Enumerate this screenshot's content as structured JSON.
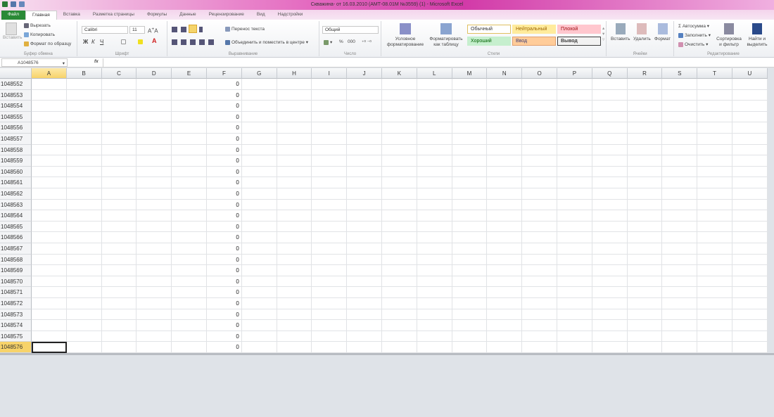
{
  "window": {
    "title": "Скважина- от 16.03.2010 (АМТ-08.01М №3559) (1) - Microsoft Excel"
  },
  "tabs": [
    "Файл",
    "Главная",
    "Вставка",
    "Разметка страницы",
    "Формулы",
    "Данные",
    "Рецензирование",
    "Вид",
    "Надстройки"
  ],
  "ribbon": {
    "clipboard": {
      "paste": "Вставить",
      "cut": "Вырезать",
      "copy": "Копировать",
      "format_painter": "Формат по образцу",
      "label": "Буфер обмена"
    },
    "font": {
      "name": "Calibri",
      "size": "11",
      "bold": "Ж",
      "italic": "К",
      "underline": "Ч",
      "label": "Шрифт"
    },
    "alignment": {
      "wrap": "Перенос текста",
      "merge": "Объединить и поместить в центре",
      "label": "Выравнивание"
    },
    "number": {
      "format": "Общий",
      "percent": "%",
      "thousands": "000",
      "label": "Число"
    },
    "styles": {
      "conditional": "Условное форматирование",
      "as_table": "Форматировать как таблицу",
      "normal": "Обычный",
      "neutral": "Нейтральный",
      "bad": "Плохой",
      "good": "Хороший",
      "input": "Ввод",
      "output": "Вывод",
      "label": "Стили"
    },
    "cells": {
      "insert": "Вставить",
      "delete": "Удалить",
      "format": "Формат",
      "label": "Ячейки"
    },
    "editing": {
      "autosum": "Автосумма",
      "fill": "Заполнить",
      "clear": "Очистить",
      "sort": "Сортировка и фильтр",
      "find": "Найти и выделить",
      "label": "Редактирование"
    }
  },
  "formula_bar": {
    "name_box": "A1048576",
    "fx": "fx",
    "value": ""
  },
  "sheet": {
    "columns": [
      "A",
      "B",
      "C",
      "D",
      "E",
      "F",
      "G",
      "H",
      "I",
      "J",
      "K",
      "L",
      "M",
      "N",
      "O",
      "P",
      "Q",
      "R",
      "S",
      "T",
      "U"
    ],
    "rows": [
      "1048552",
      "1048553",
      "1048554",
      "1048555",
      "1048556",
      "1048557",
      "1048558",
      "1048559",
      "1048560",
      "1048561",
      "1048562",
      "1048563",
      "1048564",
      "1048565",
      "1048566",
      "1048567",
      "1048568",
      "1048569",
      "1048570",
      "1048571",
      "1048572",
      "1048573",
      "1048574",
      "1048575",
      "1048576"
    ],
    "column_F_values": [
      "0",
      "0",
      "0",
      "0",
      "0",
      "0",
      "0",
      "0",
      "0",
      "0",
      "0",
      "0",
      "0",
      "0",
      "0",
      "0",
      "0",
      "0",
      "0",
      "0",
      "0",
      "0",
      "0",
      "0",
      "0"
    ],
    "selected_cell": "A1048576"
  }
}
